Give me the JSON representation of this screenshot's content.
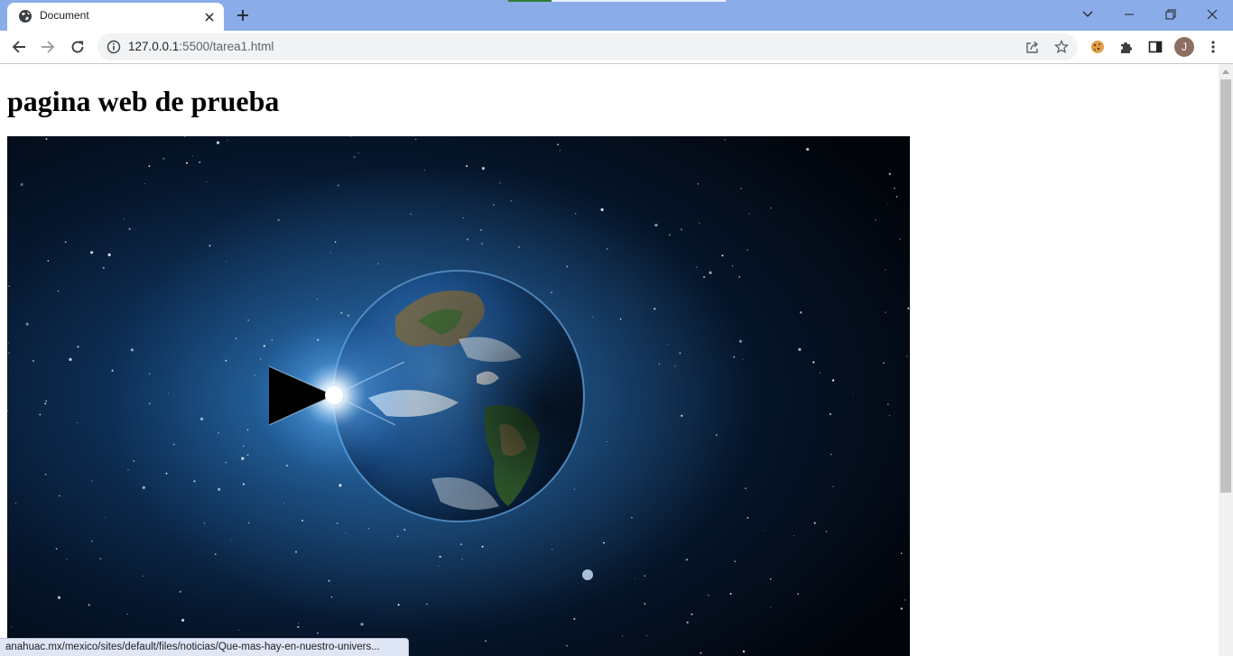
{
  "browser": {
    "tab": {
      "title": "Document"
    },
    "address_bar": {
      "host": "127.0.0.1",
      "rest": ":5500/tarea1.html"
    },
    "profile": {
      "initial": "J"
    },
    "status_url": "anahuac.mx/mexico/sites/default/files/noticias/Que-mas-hay-en-nuestro-univers..."
  },
  "page": {
    "heading": "pagina web de prueba"
  },
  "colors": {
    "titlebar": "#8aadea",
    "omnibox": "#f1f3f4",
    "avatar": "#8d6e63"
  }
}
